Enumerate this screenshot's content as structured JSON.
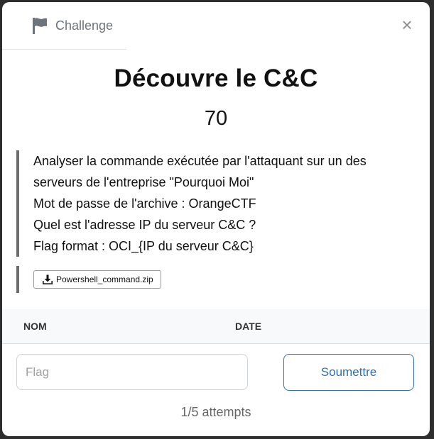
{
  "header": {
    "tab_label": "Challenge",
    "close_glyph": "×",
    "icons": {
      "tab": "flag-icon",
      "close": "close-icon"
    }
  },
  "challenge": {
    "name": "Découvre le C&C",
    "points": "70",
    "description_lines": [
      "Analyser la commande exécutée par l'attaquant sur un des",
      "serveurs de l'entreprise \"Pourquoi Moi\"",
      "Mot de passe de l'archive : OrangeCTF",
      "Quel est l'adresse IP du serveur C&C ?",
      "Flag format : OCI_{IP du serveur C&C}"
    ],
    "file": {
      "label": "Powershell_command.zip",
      "icon": "download-icon"
    }
  },
  "solves_table": {
    "columns": [
      "NOM",
      "DATE"
    ]
  },
  "submission": {
    "placeholder": "Flag",
    "value": "",
    "submit_label": "Soumettre",
    "attempts": "1/5 attempts"
  },
  "colors": {
    "accent": "#2f6fb5",
    "border_quote": "#6c6c6c",
    "muted_text": "#6c757d"
  }
}
